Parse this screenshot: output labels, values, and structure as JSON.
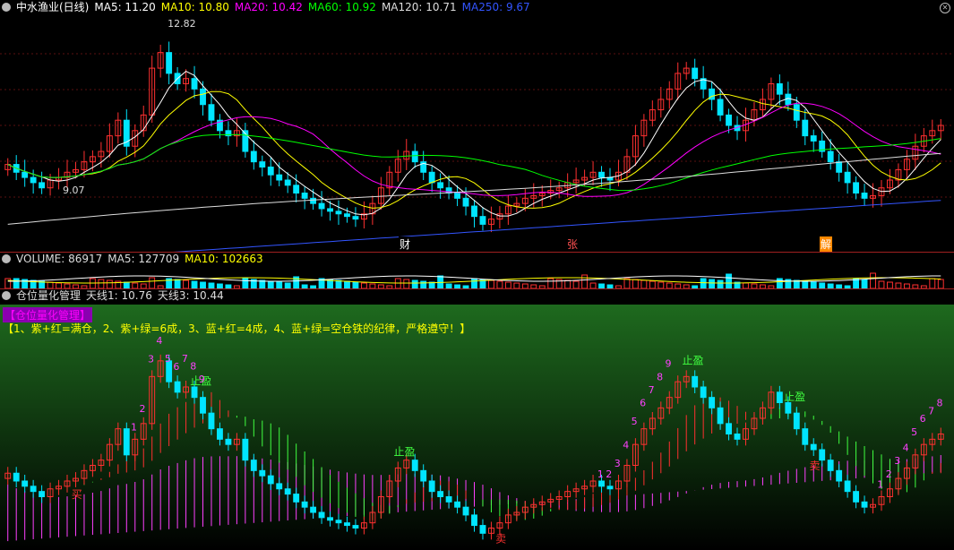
{
  "main": {
    "title": "中水渔业(日线)",
    "ma_labels": [
      {
        "text": "MA5: 11.20",
        "color": "#ffffff"
      },
      {
        "text": "MA10: 10.80",
        "color": "#ffff00"
      },
      {
        "text": "MA20: 10.42",
        "color": "#ff00ff"
      },
      {
        "text": "MA60: 10.92",
        "color": "#00ff00"
      },
      {
        "text": "MA120: 10.71",
        "color": "#dddddd"
      },
      {
        "text": "MA250: 9.67",
        "color": "#3355ff"
      }
    ],
    "high_label": "12.82",
    "low_label": "9.07",
    "events": [
      "财",
      "张",
      "解"
    ]
  },
  "volume": {
    "labels": [
      {
        "text": "VOLUME: 86917",
        "color": "#dddddd"
      },
      {
        "text": "MA5: 127709",
        "color": "#dddddd"
      },
      {
        "text": "MA10: 102663",
        "color": "#ffff00"
      }
    ]
  },
  "indicator": {
    "title": "仓位量化管理",
    "lines": [
      {
        "text": "天线1: 10.76",
        "color": "#dddddd"
      },
      {
        "text": "天线3: 10.44",
        "color": "#dddddd"
      }
    ],
    "box_title": "【仓位量化管理】",
    "note": "【1、紫+红=满仓，2、紫+绿=6成，3、蓝+红=4成，4、蓝+绿=空仓铁的纪律，严格遵守！】",
    "markers": [
      "买",
      "卖",
      "止盈",
      "1",
      "2",
      "3",
      "4",
      "5",
      "6",
      "7",
      "8",
      "9"
    ]
  },
  "colors": {
    "up": "#ff3030",
    "down": "#00e5ff",
    "vol_up": "#ff3030",
    "vol_down": "#00e5ff"
  },
  "chart_data": {
    "type": "candlestick",
    "price_range": [
      9.0,
      13.2
    ],
    "closes": [
      10.35,
      10.2,
      10.1,
      10.0,
      9.9,
      10.05,
      10.1,
      10.2,
      10.25,
      10.4,
      10.5,
      10.6,
      10.9,
      11.2,
      10.7,
      11.0,
      11.3,
      12.2,
      12.5,
      12.1,
      11.9,
      12.0,
      11.8,
      11.5,
      11.2,
      11.0,
      10.9,
      11.0,
      10.6,
      10.4,
      10.3,
      10.15,
      10.05,
      9.95,
      9.8,
      9.7,
      9.6,
      9.5,
      9.45,
      9.4,
      9.35,
      9.3,
      9.4,
      9.6,
      9.9,
      10.2,
      10.45,
      10.6,
      10.4,
      10.2,
      10.0,
      9.9,
      9.8,
      9.7,
      9.55,
      9.35,
      9.2,
      9.3,
      9.4,
      9.55,
      9.6,
      9.7,
      9.75,
      9.8,
      9.85,
      9.9,
      10.0,
      10.05,
      10.1,
      10.2,
      10.1,
      10.05,
      10.2,
      10.5,
      10.9,
      11.2,
      11.4,
      11.6,
      11.8,
      12.1,
      12.2,
      12.0,
      11.8,
      11.6,
      11.3,
      11.1,
      11.0,
      11.2,
      11.4,
      11.6,
      11.9,
      11.7,
      11.5,
      11.2,
      10.9,
      10.8,
      10.6,
      10.4,
      10.2,
      10.0,
      9.8,
      9.7,
      9.75,
      9.9,
      10.05,
      10.25,
      10.45,
      10.7,
      10.9,
      11.0,
      11.1
    ]
  }
}
